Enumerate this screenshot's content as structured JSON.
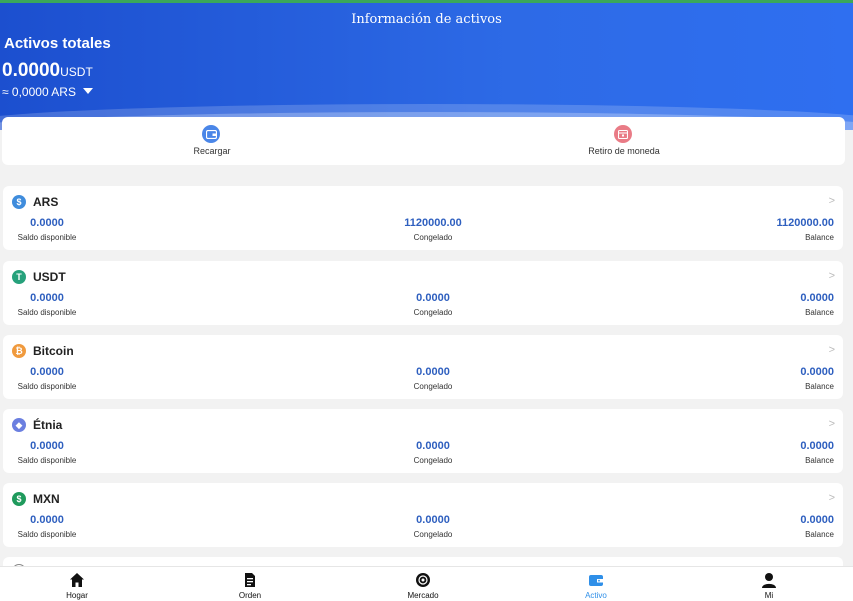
{
  "header": {
    "title": "Información de activos",
    "total_label": "Activos totales",
    "total_amount": "0.0000",
    "total_unit": "USDT",
    "converted": "≈ 0,0000",
    "converted_currency": "ARS"
  },
  "actions": [
    {
      "label": "Recargar",
      "icon": "wallet-icon",
      "color": "#4a86e8"
    },
    {
      "label": "Retiro de moneda",
      "icon": "calendar-icon",
      "color": "#e97b86"
    }
  ],
  "assets": [
    {
      "name": "ARS",
      "icon": "dollar-icon",
      "icon_color": "#3f8cdc",
      "icon_glyph": "$",
      "available": "0.0000",
      "frozen": "1120000.00",
      "balance": "1120000.00"
    },
    {
      "name": "USDT",
      "icon": "tether-icon",
      "icon_color": "#26a17b",
      "icon_glyph": "T",
      "available": "0.0000",
      "frozen": "0.0000",
      "balance": "0.0000"
    },
    {
      "name": "Bitcoin",
      "icon": "bitcoin-icon",
      "icon_color": "#f09a3e",
      "icon_glyph": "₿",
      "available": "0.0000",
      "frozen": "0.0000",
      "balance": "0.0000"
    },
    {
      "name": "Étnia",
      "icon": "ethereum-icon",
      "icon_color": "#6b7fe0",
      "icon_glyph": "◆",
      "available": "0.0000",
      "frozen": "0.0000",
      "balance": "0.0000"
    },
    {
      "name": "MXN",
      "icon": "dollar-icon",
      "icon_color": "#1f9a5c",
      "icon_glyph": "$",
      "available": "0.0000",
      "frozen": "0.0000",
      "balance": "0.0000"
    }
  ],
  "labels": {
    "available": "Saldo disponible",
    "frozen": "Congelado",
    "balance": "Balance"
  },
  "tabs": [
    {
      "label": "Hogar",
      "icon": "home-icon",
      "active": false
    },
    {
      "label": "Orden",
      "icon": "document-icon",
      "active": false
    },
    {
      "label": "Mercado",
      "icon": "market-icon",
      "active": false
    },
    {
      "label": "Activo",
      "icon": "wallet-icon",
      "active": true
    },
    {
      "label": "Mi",
      "icon": "user-icon",
      "active": false
    }
  ],
  "colors": {
    "header_gradient_start": "#1c4fcf",
    "header_gradient_end": "#2f6ff0",
    "value_blue": "#2e5fbf",
    "active_tab": "#2f8fe8"
  }
}
